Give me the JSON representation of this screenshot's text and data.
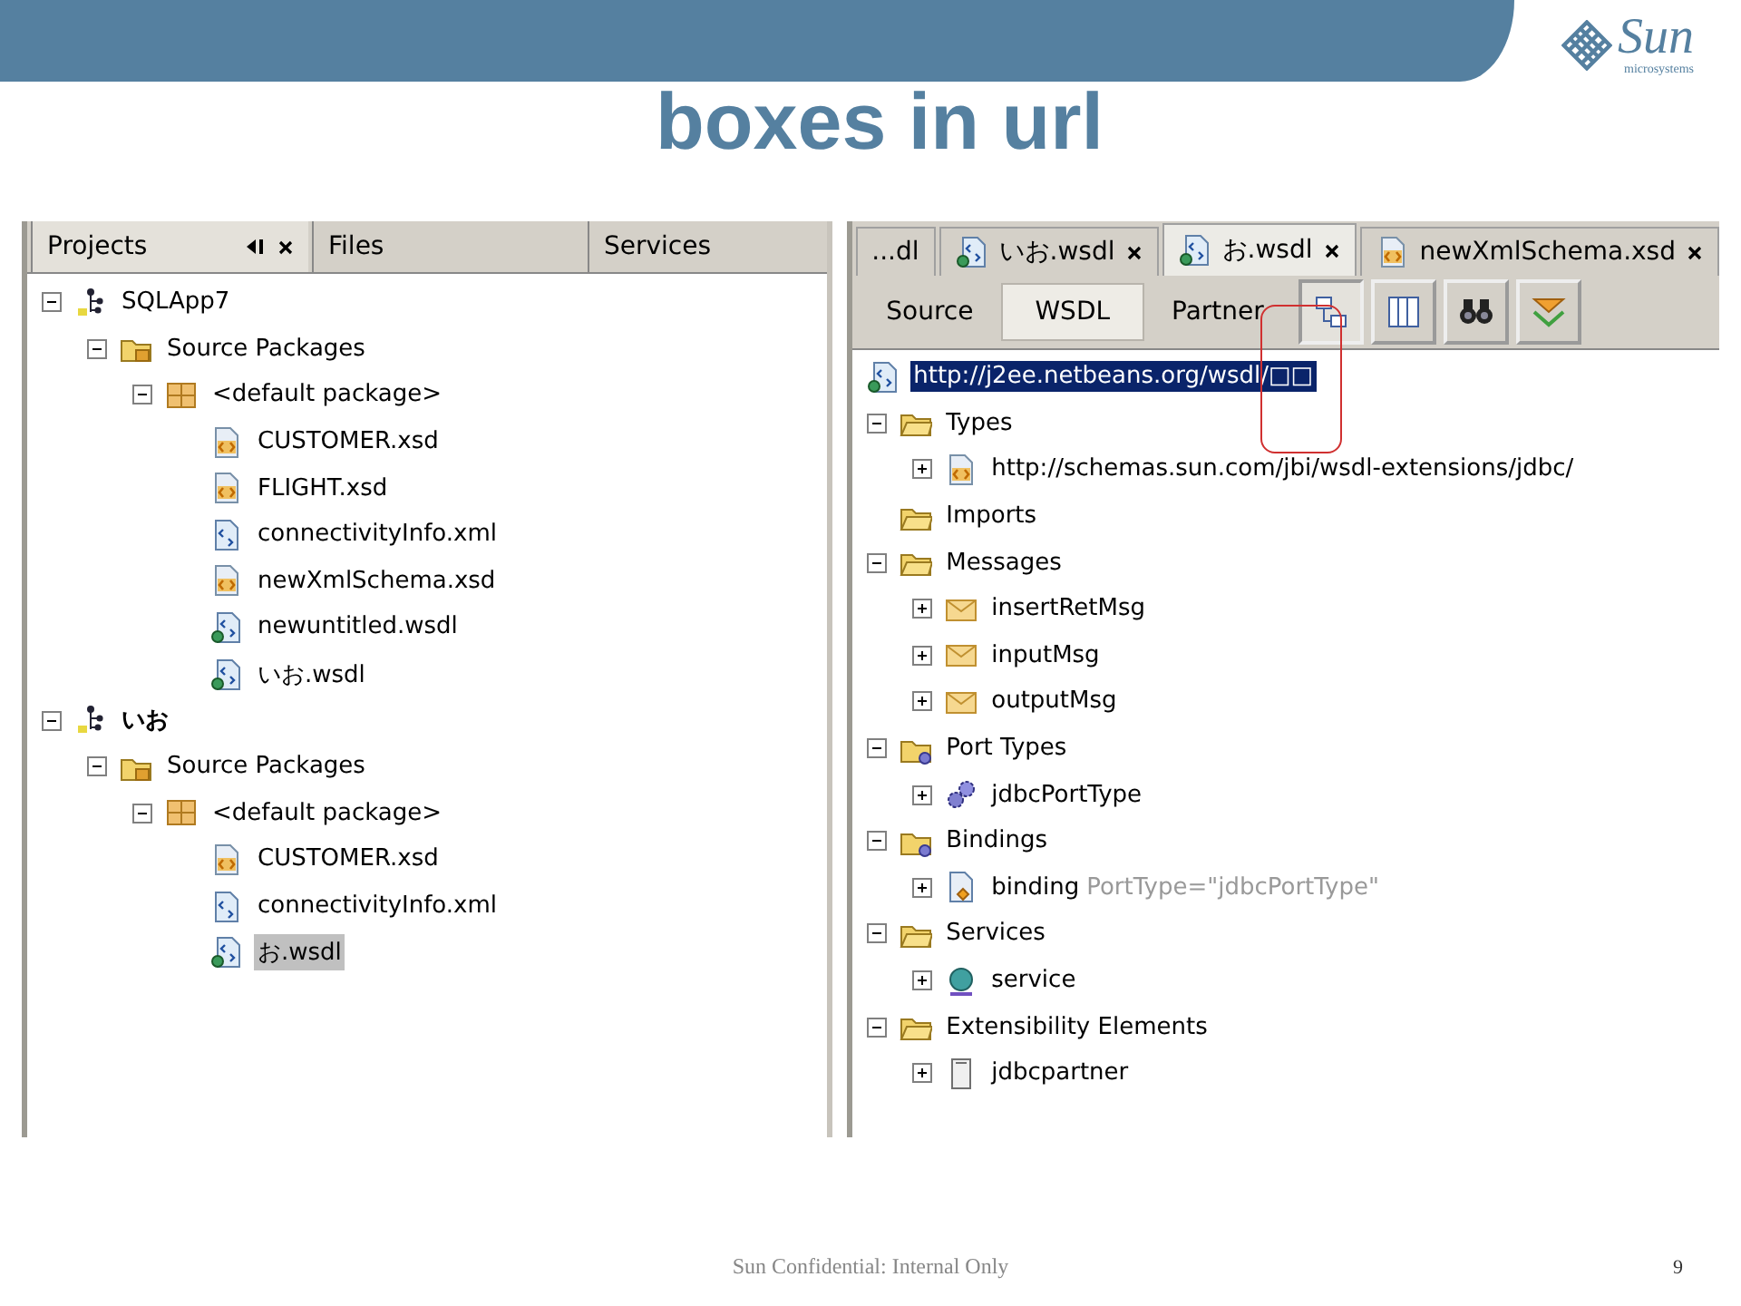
{
  "slide": {
    "logo": {
      "name": "Sun",
      "tagline": "microsystems"
    },
    "title": "boxes in url",
    "footer": "Sun Confidential: Internal Only",
    "page_number": "9"
  },
  "projects": {
    "tabs": [
      {
        "label": "Projects",
        "selected": true
      },
      {
        "label": "Files",
        "selected": false
      },
      {
        "label": "Services",
        "selected": false
      }
    ],
    "tree": [
      {
        "label": "SQLApp7",
        "kind": "project",
        "main": false,
        "expanded": true,
        "selected": false,
        "children": [
          {
            "label": "Source Packages",
            "kind": "source",
            "expanded": true,
            "selected": false,
            "children": [
              {
                "label": "<default package>",
                "kind": "package",
                "expanded": true,
                "selected": false,
                "children": [
                  {
                    "label": "CUSTOMER.xsd",
                    "kind": "xsd",
                    "selected": false
                  },
                  {
                    "label": "FLIGHT.xsd",
                    "kind": "xsd",
                    "selected": false
                  },
                  {
                    "label": "connectivityInfo.xml",
                    "kind": "xml",
                    "selected": false
                  },
                  {
                    "label": "newXmlSchema.xsd",
                    "kind": "xsd",
                    "selected": false
                  },
                  {
                    "label": "newuntitled.wsdl",
                    "kind": "wsdl",
                    "selected": false
                  },
                  {
                    "label": "いお.wsdl",
                    "kind": "wsdl",
                    "selected": false
                  }
                ]
              }
            ]
          }
        ]
      },
      {
        "label": "いお",
        "kind": "project",
        "main": true,
        "expanded": true,
        "selected": false,
        "children": [
          {
            "label": "Source Packages",
            "kind": "source",
            "expanded": true,
            "selected": false,
            "children": [
              {
                "label": "<default package>",
                "kind": "package",
                "expanded": true,
                "selected": false,
                "children": [
                  {
                    "label": "CUSTOMER.xsd",
                    "kind": "xsd",
                    "selected": false
                  },
                  {
                    "label": "connectivityInfo.xml",
                    "kind": "xml",
                    "selected": false
                  },
                  {
                    "label": "お.wsdl",
                    "kind": "wsdl",
                    "selected": true
                  }
                ]
              }
            ]
          }
        ]
      }
    ]
  },
  "editor": {
    "tabs": [
      {
        "label": "...dl",
        "kind": "plain",
        "closable": false,
        "selected": false
      },
      {
        "label": "いお.wsdl",
        "kind": "wsdl",
        "closable": true,
        "selected": false
      },
      {
        "label": "お.wsdl",
        "kind": "wsdl",
        "closable": true,
        "selected": true
      },
      {
        "label": "newXmlSchema.xsd",
        "kind": "xsd",
        "closable": true,
        "selected": false
      }
    ],
    "views": [
      {
        "label": "Source",
        "selected": false
      },
      {
        "label": "WSDL",
        "selected": true
      },
      {
        "label": "Partner",
        "selected": false
      }
    ],
    "tools": [
      {
        "kind": "tree",
        "pressed": true
      },
      {
        "kind": "columns",
        "pressed": false
      },
      {
        "kind": "find",
        "pressed": false
      },
      {
        "kind": "collapse",
        "pressed": false
      }
    ],
    "namespace": {
      "label": "http://j2ee.netbeans.org/wsdl/□□",
      "kind": "wsdl",
      "selected": true
    },
    "tree": [
      {
        "label": "Types",
        "kind": "folder",
        "expanded": true,
        "selected": false,
        "children": [
          {
            "label": "http://schemas.sun.com/jbi/wsdl-extensions/jdbc/",
            "kind": "xsd",
            "expanded": false,
            "selected": false
          }
        ]
      },
      {
        "label": "Imports",
        "kind": "folder",
        "selected": false
      },
      {
        "label": "Messages",
        "kind": "folder",
        "expanded": true,
        "selected": false,
        "children": [
          {
            "label": "insertRetMsg",
            "kind": "message",
            "expanded": false,
            "selected": false
          },
          {
            "label": "inputMsg",
            "kind": "message",
            "expanded": false,
            "selected": false
          },
          {
            "label": "outputMsg",
            "kind": "message",
            "expanded": false,
            "selected": false
          }
        ]
      },
      {
        "label": "Port Types",
        "kind": "folder-gear",
        "expanded": true,
        "selected": false,
        "children": [
          {
            "label": "jdbcPortType",
            "kind": "gears",
            "expanded": false,
            "selected": false
          }
        ]
      },
      {
        "label": "Bindings",
        "kind": "folder-gear",
        "expanded": true,
        "selected": false,
        "children": [
          {
            "label": "binding",
            "detail": "PortType=\"jdbcPortType\"",
            "kind": "binding",
            "expanded": false,
            "selected": false
          }
        ]
      },
      {
        "label": "Services",
        "kind": "folder",
        "expanded": true,
        "selected": false,
        "children": [
          {
            "label": "service",
            "kind": "service",
            "expanded": false,
            "selected": false
          }
        ]
      },
      {
        "label": "Extensibility Elements",
        "kind": "folder",
        "expanded": true,
        "selected": false,
        "children": [
          {
            "label": "jdbcpartner",
            "kind": "partner",
            "expanded": false,
            "selected": false
          }
        ]
      }
    ]
  }
}
